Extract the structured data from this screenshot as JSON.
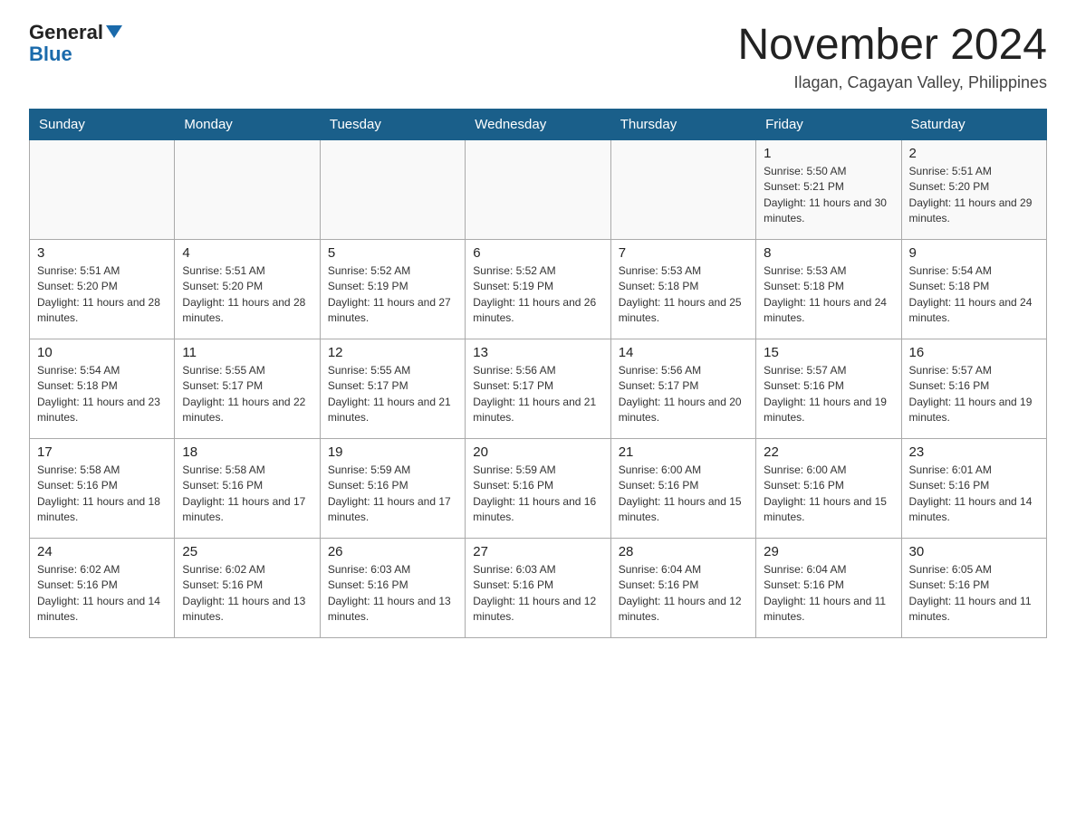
{
  "header": {
    "logo_general": "General",
    "logo_blue": "Blue",
    "month_title": "November 2024",
    "subtitle": "Ilagan, Cagayan Valley, Philippines"
  },
  "days_of_week": [
    "Sunday",
    "Monday",
    "Tuesday",
    "Wednesday",
    "Thursday",
    "Friday",
    "Saturday"
  ],
  "weeks": [
    [
      {
        "day": "",
        "sunrise": "",
        "sunset": "",
        "daylight": ""
      },
      {
        "day": "",
        "sunrise": "",
        "sunset": "",
        "daylight": ""
      },
      {
        "day": "",
        "sunrise": "",
        "sunset": "",
        "daylight": ""
      },
      {
        "day": "",
        "sunrise": "",
        "sunset": "",
        "daylight": ""
      },
      {
        "day": "",
        "sunrise": "",
        "sunset": "",
        "daylight": ""
      },
      {
        "day": "1",
        "sunrise": "Sunrise: 5:50 AM",
        "sunset": "Sunset: 5:21 PM",
        "daylight": "Daylight: 11 hours and 30 minutes."
      },
      {
        "day": "2",
        "sunrise": "Sunrise: 5:51 AM",
        "sunset": "Sunset: 5:20 PM",
        "daylight": "Daylight: 11 hours and 29 minutes."
      }
    ],
    [
      {
        "day": "3",
        "sunrise": "Sunrise: 5:51 AM",
        "sunset": "Sunset: 5:20 PM",
        "daylight": "Daylight: 11 hours and 28 minutes."
      },
      {
        "day": "4",
        "sunrise": "Sunrise: 5:51 AM",
        "sunset": "Sunset: 5:20 PM",
        "daylight": "Daylight: 11 hours and 28 minutes."
      },
      {
        "day": "5",
        "sunrise": "Sunrise: 5:52 AM",
        "sunset": "Sunset: 5:19 PM",
        "daylight": "Daylight: 11 hours and 27 minutes."
      },
      {
        "day": "6",
        "sunrise": "Sunrise: 5:52 AM",
        "sunset": "Sunset: 5:19 PM",
        "daylight": "Daylight: 11 hours and 26 minutes."
      },
      {
        "day": "7",
        "sunrise": "Sunrise: 5:53 AM",
        "sunset": "Sunset: 5:18 PM",
        "daylight": "Daylight: 11 hours and 25 minutes."
      },
      {
        "day": "8",
        "sunrise": "Sunrise: 5:53 AM",
        "sunset": "Sunset: 5:18 PM",
        "daylight": "Daylight: 11 hours and 24 minutes."
      },
      {
        "day": "9",
        "sunrise": "Sunrise: 5:54 AM",
        "sunset": "Sunset: 5:18 PM",
        "daylight": "Daylight: 11 hours and 24 minutes."
      }
    ],
    [
      {
        "day": "10",
        "sunrise": "Sunrise: 5:54 AM",
        "sunset": "Sunset: 5:18 PM",
        "daylight": "Daylight: 11 hours and 23 minutes."
      },
      {
        "day": "11",
        "sunrise": "Sunrise: 5:55 AM",
        "sunset": "Sunset: 5:17 PM",
        "daylight": "Daylight: 11 hours and 22 minutes."
      },
      {
        "day": "12",
        "sunrise": "Sunrise: 5:55 AM",
        "sunset": "Sunset: 5:17 PM",
        "daylight": "Daylight: 11 hours and 21 minutes."
      },
      {
        "day": "13",
        "sunrise": "Sunrise: 5:56 AM",
        "sunset": "Sunset: 5:17 PM",
        "daylight": "Daylight: 11 hours and 21 minutes."
      },
      {
        "day": "14",
        "sunrise": "Sunrise: 5:56 AM",
        "sunset": "Sunset: 5:17 PM",
        "daylight": "Daylight: 11 hours and 20 minutes."
      },
      {
        "day": "15",
        "sunrise": "Sunrise: 5:57 AM",
        "sunset": "Sunset: 5:16 PM",
        "daylight": "Daylight: 11 hours and 19 minutes."
      },
      {
        "day": "16",
        "sunrise": "Sunrise: 5:57 AM",
        "sunset": "Sunset: 5:16 PM",
        "daylight": "Daylight: 11 hours and 19 minutes."
      }
    ],
    [
      {
        "day": "17",
        "sunrise": "Sunrise: 5:58 AM",
        "sunset": "Sunset: 5:16 PM",
        "daylight": "Daylight: 11 hours and 18 minutes."
      },
      {
        "day": "18",
        "sunrise": "Sunrise: 5:58 AM",
        "sunset": "Sunset: 5:16 PM",
        "daylight": "Daylight: 11 hours and 17 minutes."
      },
      {
        "day": "19",
        "sunrise": "Sunrise: 5:59 AM",
        "sunset": "Sunset: 5:16 PM",
        "daylight": "Daylight: 11 hours and 17 minutes."
      },
      {
        "day": "20",
        "sunrise": "Sunrise: 5:59 AM",
        "sunset": "Sunset: 5:16 PM",
        "daylight": "Daylight: 11 hours and 16 minutes."
      },
      {
        "day": "21",
        "sunrise": "Sunrise: 6:00 AM",
        "sunset": "Sunset: 5:16 PM",
        "daylight": "Daylight: 11 hours and 15 minutes."
      },
      {
        "day": "22",
        "sunrise": "Sunrise: 6:00 AM",
        "sunset": "Sunset: 5:16 PM",
        "daylight": "Daylight: 11 hours and 15 minutes."
      },
      {
        "day": "23",
        "sunrise": "Sunrise: 6:01 AM",
        "sunset": "Sunset: 5:16 PM",
        "daylight": "Daylight: 11 hours and 14 minutes."
      }
    ],
    [
      {
        "day": "24",
        "sunrise": "Sunrise: 6:02 AM",
        "sunset": "Sunset: 5:16 PM",
        "daylight": "Daylight: 11 hours and 14 minutes."
      },
      {
        "day": "25",
        "sunrise": "Sunrise: 6:02 AM",
        "sunset": "Sunset: 5:16 PM",
        "daylight": "Daylight: 11 hours and 13 minutes."
      },
      {
        "day": "26",
        "sunrise": "Sunrise: 6:03 AM",
        "sunset": "Sunset: 5:16 PM",
        "daylight": "Daylight: 11 hours and 13 minutes."
      },
      {
        "day": "27",
        "sunrise": "Sunrise: 6:03 AM",
        "sunset": "Sunset: 5:16 PM",
        "daylight": "Daylight: 11 hours and 12 minutes."
      },
      {
        "day": "28",
        "sunrise": "Sunrise: 6:04 AM",
        "sunset": "Sunset: 5:16 PM",
        "daylight": "Daylight: 11 hours and 12 minutes."
      },
      {
        "day": "29",
        "sunrise": "Sunrise: 6:04 AM",
        "sunset": "Sunset: 5:16 PM",
        "daylight": "Daylight: 11 hours and 11 minutes."
      },
      {
        "day": "30",
        "sunrise": "Sunrise: 6:05 AM",
        "sunset": "Sunset: 5:16 PM",
        "daylight": "Daylight: 11 hours and 11 minutes."
      }
    ]
  ]
}
